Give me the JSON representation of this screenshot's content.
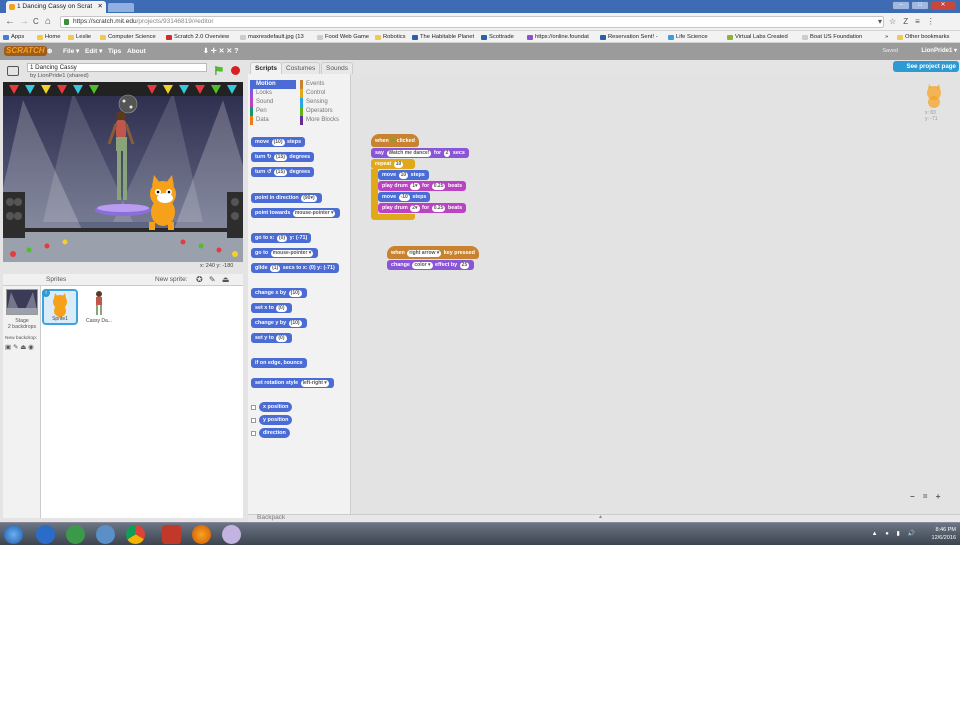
{
  "browser": {
    "tab_title": "1 Dancing Cassy on Scrat",
    "tab_close": "✕",
    "url_domain": "https://scratch.mit.edu",
    "url_path": "/projects/93146819/#editor",
    "nav_back": "←",
    "nav_forward": "→",
    "nav_reload": "C",
    "nav_home": "⌂",
    "right_icons": [
      "▾",
      "☆",
      "Z",
      "≡",
      "⋮"
    ],
    "window_buttons": [
      "–",
      "□",
      "✕"
    ]
  },
  "bookmarks": [
    {
      "label": "Apps",
      "color": "#4a7bd0"
    },
    {
      "label": "Home",
      "color": "#f2c94c"
    },
    {
      "label": "Leslie",
      "color": "#f2c94c"
    },
    {
      "label": "Computer Science",
      "color": "#f2c94c"
    },
    {
      "label": "Scratch 2.0 Overview",
      "color": "#d32b2b"
    },
    {
      "label": "maxresdefault.jpg (13",
      "color": "#999999"
    },
    {
      "label": "Food Web Game",
      "color": "#999999"
    },
    {
      "label": "Robotics",
      "color": "#f2c94c"
    },
    {
      "label": "The Habitable Planet",
      "color": "#2a60a8"
    },
    {
      "label": "Scottrade",
      "color": "#2a60a8"
    },
    {
      "label": "https://online.foundat",
      "color": "#8855cc"
    },
    {
      "label": "Reservation Sent! -",
      "color": "#2a60a8"
    },
    {
      "label": "Life Science",
      "color": "#3aa0d8"
    },
    {
      "label": "Virtual Labs Created",
      "color": "#8fb33a"
    },
    {
      "label": "Boat US Foundation",
      "color": "#999999"
    }
  ],
  "bookmarks_more": "»",
  "bookmarks_other": "Other bookmarks",
  "scratch_menu": {
    "logo": "SCRATCH",
    "globe": "⊕",
    "items": [
      "File ▾",
      "Edit ▾",
      "Tips",
      "About"
    ],
    "tools": "⬇ ✛ ✕ ✕ ?",
    "saved": "Saved",
    "user": "LionPride1 ▾"
  },
  "project": {
    "title": "1 Dancing Cassy",
    "byline": "by LionPride1 (shared)"
  },
  "stage": {
    "coords": "x: 240  y: -180"
  },
  "sprites_pane": {
    "title": "Sprites",
    "new_sprite": "New sprite:",
    "new_sprite_icons": "✪ ✎ ⏏ ◉",
    "stage_label": "Stage",
    "stage_backdrops": "2 backdrops",
    "new_backdrop": "New backdrop:",
    "new_backdrop_icons": "▣ ✎ ⏏ ◉",
    "sprites": [
      {
        "name": "Sprite1",
        "selected": true
      },
      {
        "name": "Cassy Da...",
        "selected": false
      }
    ]
  },
  "editor": {
    "tabs": [
      "Scripts",
      "Costumes",
      "Sounds"
    ],
    "active_tab": "Scripts",
    "see_project": "See project page",
    "categories": [
      {
        "label": "Motion",
        "color": "#4a6cd4",
        "active": true
      },
      {
        "label": "Events",
        "color": "#c88330"
      },
      {
        "label": "Looks",
        "color": "#8a55d7"
      },
      {
        "label": "Control",
        "color": "#e1a91a"
      },
      {
        "label": "Sound",
        "color": "#bb42c3"
      },
      {
        "label": "Sensing",
        "color": "#2ca5e2"
      },
      {
        "label": "Pen",
        "color": "#0e9a6c"
      },
      {
        "label": "Operators",
        "color": "#5cb712"
      },
      {
        "label": "Data",
        "color": "#ee7d16"
      },
      {
        "label": "More Blocks",
        "color": "#632d99"
      }
    ],
    "palette_blocks": [
      {
        "parts": [
          "move ",
          "(10)",
          " steps"
        ]
      },
      {
        "parts": [
          "turn ↻ ",
          "(15)",
          " degrees"
        ]
      },
      {
        "parts": [
          "turn ↺ ",
          "(15)",
          " degrees"
        ]
      },
      {
        "parts": [
          "point in direction ",
          "(90▾)",
          ""
        ]
      },
      {
        "parts": [
          "point towards ",
          "mouse-pointer ▾",
          ""
        ]
      },
      {
        "parts": [
          "go to x: ",
          "(0)",
          " y: (-71)"
        ]
      },
      {
        "parts": [
          "go to ",
          "mouse-pointer ▾",
          ""
        ]
      },
      {
        "parts": [
          "glide ",
          "(1)",
          " secs to x: (0) y: (-71)"
        ]
      },
      {
        "parts": [
          "change x by ",
          "(10)",
          ""
        ]
      },
      {
        "parts": [
          "set x to ",
          "(0)",
          ""
        ]
      },
      {
        "parts": [
          "change y by ",
          "(10)",
          ""
        ]
      },
      {
        "parts": [
          "set y to ",
          "(0)",
          ""
        ]
      },
      {
        "parts": [
          "if on edge, bounce",
          "",
          ""
        ]
      },
      {
        "parts": [
          "set rotation style ",
          "left-right ▾",
          ""
        ]
      }
    ],
    "reporters": [
      "x position",
      "y position",
      "direction"
    ],
    "sprite_info": {
      "x": "x: 83",
      "y": "y: -71"
    },
    "zoom_controls": "− = +",
    "backpack": "Backpack",
    "backpack_arrow": "▲"
  },
  "scripts": {
    "script1": {
      "hat": [
        "when ",
        "⚑",
        " clicked"
      ],
      "say": [
        "say ",
        "Watch me dance!",
        " for ",
        "2",
        " secs"
      ],
      "repeat": [
        "repeat ",
        "10"
      ],
      "move1": [
        "move ",
        "10",
        " steps"
      ],
      "drum1": [
        "play drum ",
        "1▾",
        " for ",
        "0.25",
        " beats"
      ],
      "move2": [
        "move ",
        "-10",
        " steps"
      ],
      "drum2": [
        "play drum ",
        "2▾",
        " for ",
        "0.25",
        " beats"
      ]
    },
    "script2": {
      "hat": [
        "when ",
        "right arrow ▾",
        " key pressed"
      ],
      "effect": [
        "change ",
        "color ▾",
        " effect by ",
        "25"
      ]
    }
  },
  "taskbar": {
    "time": "8:46 PM",
    "date": "12/6/2016",
    "tray_icons": "▲ ● ▮ 🔊"
  }
}
